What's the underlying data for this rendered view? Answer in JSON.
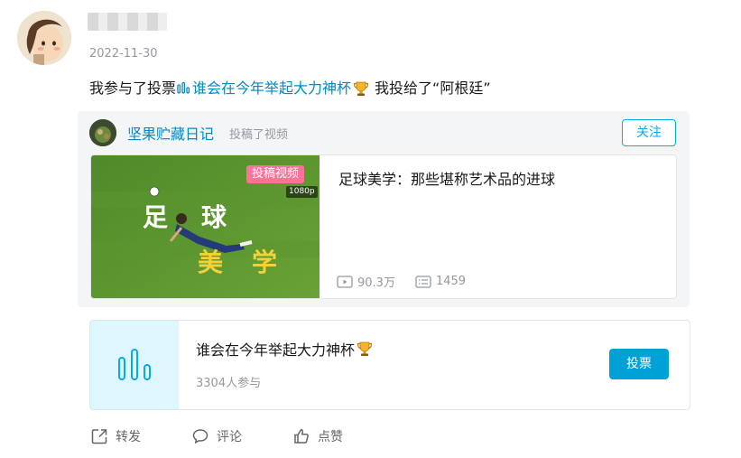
{
  "post": {
    "author_name": "",
    "date": "2022-11-30",
    "text_prefix": "我参与了投票",
    "poll_link": "谁会在今年举起大力神杯",
    "text_suffix": "我投给了“阿根廷”"
  },
  "shared": {
    "uploader_name": "坚果贮藏日记",
    "uploader_action": "投稿了视频",
    "follow_label": "关注",
    "video": {
      "badge": "投稿视频",
      "quality": "1080p",
      "thumb_text_1": "足",
      "thumb_text_2": "球",
      "thumb_text_3": "美",
      "thumb_text_4": "学",
      "title": "足球美学：那些堪称艺术品的进球",
      "views": "90.3万",
      "danmaku": "1459"
    }
  },
  "poll": {
    "title": "谁会在今年举起大力神杯",
    "participants": "3304人参与",
    "vote_label": "投票"
  },
  "actions": {
    "forward": "转发",
    "comment": "评论",
    "like": "点赞"
  },
  "colors": {
    "link": "#008ac5",
    "accent": "#00aeec",
    "vote_button": "#00a1d6",
    "badge_pink": "#fb7299",
    "poll_icon_bg": "#def6fe"
  },
  "icons": {
    "poll_mini": "poll-bars-icon",
    "trophy": "trophy-icon",
    "play": "play-count-icon",
    "danmaku": "danmaku-icon",
    "forward": "forward-icon",
    "comment": "comment-icon",
    "like": "like-icon"
  }
}
